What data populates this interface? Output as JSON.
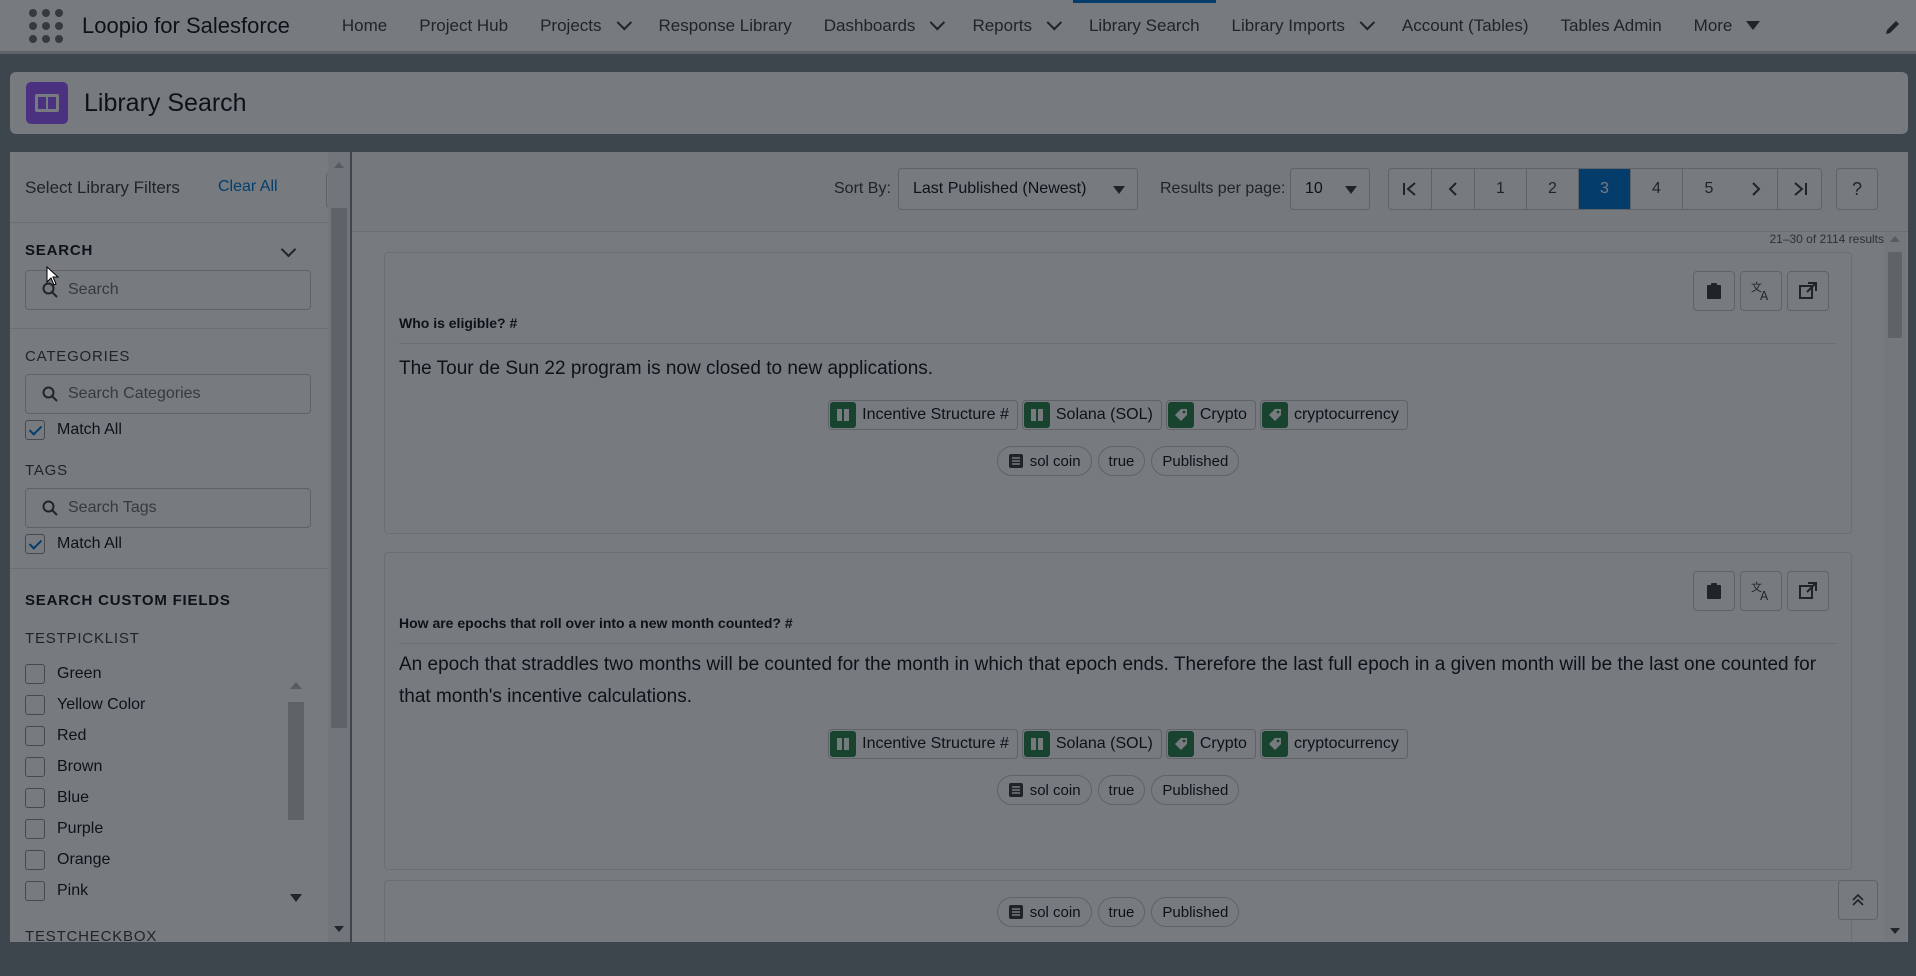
{
  "app": {
    "name": "Loopio for Salesforce",
    "nav": [
      {
        "label": "Home",
        "chevron": false,
        "active": false
      },
      {
        "label": "Project Hub",
        "chevron": false,
        "active": false
      },
      {
        "label": "Projects",
        "chevron": true,
        "active": false
      },
      {
        "label": "Response Library",
        "chevron": false,
        "active": false
      },
      {
        "label": "Dashboards",
        "chevron": true,
        "active": false
      },
      {
        "label": "Reports",
        "chevron": true,
        "active": false
      },
      {
        "label": "Library Search",
        "chevron": false,
        "active": true
      },
      {
        "label": "Library Imports",
        "chevron": true,
        "active": false
      },
      {
        "label": "Account (Tables)",
        "chevron": false,
        "active": false
      },
      {
        "label": "Tables Admin",
        "chevron": false,
        "active": false
      }
    ],
    "more_label": "More"
  },
  "page": {
    "title": "Library Search",
    "icon": "book-icon",
    "accent": "#9d5dff"
  },
  "filters": {
    "heading": "Select Library Filters",
    "clear_all": "Clear All",
    "search": {
      "label": "SEARCH",
      "placeholder": "Search"
    },
    "categories": {
      "label": "CATEGORIES",
      "placeholder": "Search Categories",
      "match_all": "Match All"
    },
    "tags": {
      "label": "TAGS",
      "placeholder": "Search Tags",
      "match_all": "Match All"
    },
    "custom_fields_label": "SEARCH CUSTOM FIELDS",
    "testpicklist": {
      "label": "TESTPICKLIST",
      "options": [
        "Green",
        "Yellow Color",
        "Red",
        "Brown",
        "Blue",
        "Purple",
        "Orange",
        "Pink"
      ]
    },
    "testcheckbox_label": "TESTCHECKBOX"
  },
  "toolbar": {
    "sort_label": "Sort By:",
    "sort_value": "Last Published (Newest)",
    "per_page_label": "Results per page:",
    "per_page_value": "10",
    "pages": [
      "1",
      "2",
      "3",
      "4",
      "5"
    ],
    "current_page": "3",
    "help": "?"
  },
  "results": {
    "count_text": "21–30 of 2114 results",
    "items": [
      {
        "question": "Who is eligible? #",
        "answer": "The Tour de Sun 22 program is now closed to new applications.",
        "tags": [
          "Incentive Structure #",
          "Solana (SOL)",
          "Crypto",
          "cryptocurrency"
        ],
        "pills": [
          "sol coin",
          "true",
          "Published"
        ]
      },
      {
        "question": "How are epochs that roll over into a new month counted? #",
        "answer": "An epoch that straddles two months will be counted for the month in which that epoch ends. Therefore the last full epoch in a given month will be the last one counted for that month's incentive calculations.",
        "tags": [
          "Incentive Structure #",
          "Solana (SOL)",
          "Crypto",
          "cryptocurrency"
        ],
        "pills": [
          "sol coin",
          "true",
          "Published"
        ]
      },
      {
        "pills": [
          "sol coin",
          "true",
          "Published"
        ]
      }
    ]
  },
  "colors": {
    "brand_blue": "#0176d3",
    "tag_green": "#2e844a"
  }
}
